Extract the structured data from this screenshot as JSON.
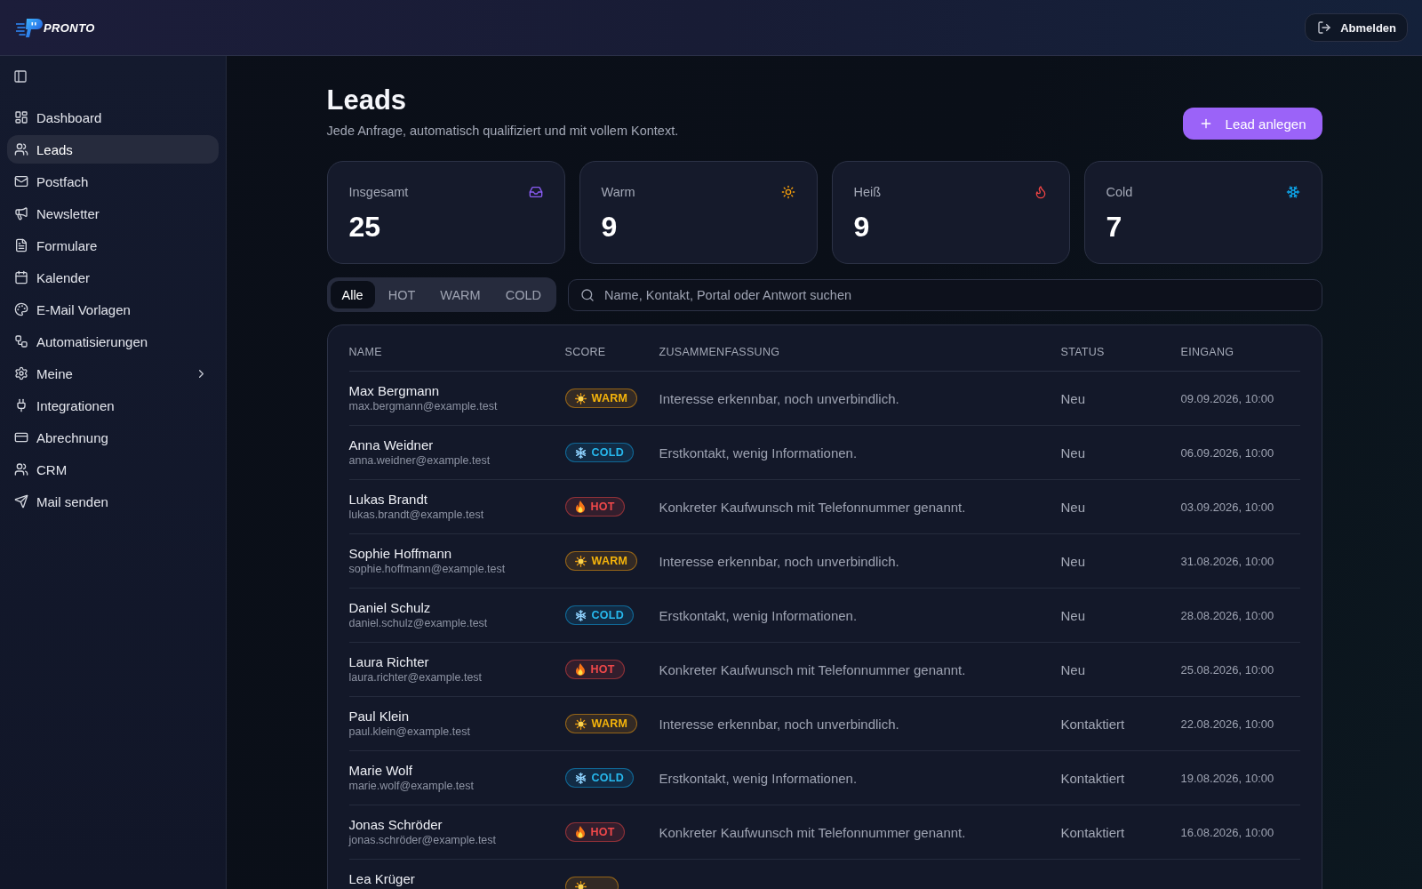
{
  "header": {
    "logo": "PRONTO",
    "logout": "Abmelden"
  },
  "sidebar": {
    "items": [
      {
        "label": "Dashboard",
        "kind": "link",
        "selected": false
      },
      {
        "label": "Leads",
        "kind": "link",
        "selected": true
      },
      {
        "label": "Postfach",
        "kind": "link",
        "selected": false
      },
      {
        "label": "Newsletter",
        "kind": "link",
        "selected": false
      },
      {
        "label": "Formulare",
        "kind": "link",
        "selected": false
      },
      {
        "label": "Kalender",
        "kind": "link",
        "selected": false
      },
      {
        "label": "E-Mail Vorlagen",
        "kind": "link",
        "selected": false
      },
      {
        "label": "Automatisierungen",
        "kind": "link",
        "selected": false
      },
      {
        "label": "Meine",
        "kind": "group",
        "expanded": false,
        "selected": false
      },
      {
        "label": "Integrationen",
        "kind": "link",
        "selected": false
      },
      {
        "label": "Abrechnung",
        "kind": "link",
        "selected": false
      },
      {
        "label": "CRM",
        "kind": "link",
        "selected": false
      },
      {
        "label": "Mail senden",
        "kind": "link",
        "selected": false
      }
    ]
  },
  "page": {
    "title": "Leads",
    "subtitle": "Jede Anfrage, automatisch qualifiziert und mit vollem Kontext.",
    "action": "Lead anlegen"
  },
  "stats": [
    {
      "kind": "total",
      "label": "Insgesamt",
      "value": "25"
    },
    {
      "kind": "warm",
      "label": "Warm",
      "value": "9"
    },
    {
      "kind": "hot",
      "label": "Heiß",
      "value": "9"
    },
    {
      "kind": "cold",
      "label": "Cold",
      "value": "7"
    }
  ],
  "filters": [
    {
      "label": "Alle",
      "selected": true
    },
    {
      "label": "HOT",
      "selected": false
    },
    {
      "label": "WARM",
      "selected": false
    },
    {
      "label": "COLD",
      "selected": false
    }
  ],
  "search": {
    "placeholder": "Name, Kontakt, Portal oder Antwort suchen"
  },
  "table": {
    "columns": [
      "NAME",
      "SCORE",
      "ZUSAMMENFASSUNG",
      "STATUS",
      "EINGANG"
    ],
    "rows": [
      {
        "name": "Max Bergmann",
        "email": "max.bergmann@example.test",
        "score": {
          "kind": "warm",
          "label": "WARM"
        },
        "summary": "Interesse erkennbar, noch unverbindlich.",
        "status": "Neu",
        "received": "09.09.2026, 10:00"
      },
      {
        "name": "Anna Weidner",
        "email": "anna.weidner@example.test",
        "score": {
          "kind": "cold",
          "label": "COLD"
        },
        "summary": "Erstkontakt, wenig Informationen.",
        "status": "Neu",
        "received": "06.09.2026, 10:00"
      },
      {
        "name": "Lukas Brandt",
        "email": "lukas.brandt@example.test",
        "score": {
          "kind": "hot",
          "label": "HOT"
        },
        "summary": "Konkreter Kaufwunsch mit Telefonnummer genannt.",
        "status": "Neu",
        "received": "03.09.2026, 10:00"
      },
      {
        "name": "Sophie Hoffmann",
        "email": "sophie.hoffmann@example.test",
        "score": {
          "kind": "warm",
          "label": "WARM"
        },
        "summary": "Interesse erkennbar, noch unverbindlich.",
        "status": "Neu",
        "received": "31.08.2026, 10:00"
      },
      {
        "name": "Daniel Schulz",
        "email": "daniel.schulz@example.test",
        "score": {
          "kind": "cold",
          "label": "COLD"
        },
        "summary": "Erstkontakt, wenig Informationen.",
        "status": "Neu",
        "received": "28.08.2026, 10:00"
      },
      {
        "name": "Laura Richter",
        "email": "laura.richter@example.test",
        "score": {
          "kind": "hot",
          "label": "HOT"
        },
        "summary": "Konkreter Kaufwunsch mit Telefonnummer genannt.",
        "status": "Neu",
        "received": "25.08.2026, 10:00"
      },
      {
        "name": "Paul Klein",
        "email": "paul.klein@example.test",
        "score": {
          "kind": "warm",
          "label": "WARM"
        },
        "summary": "Interesse erkennbar, noch unverbindlich.",
        "status": "Kontaktiert",
        "received": "22.08.2026, 10:00"
      },
      {
        "name": "Marie Wolf",
        "email": "marie.wolf@example.test",
        "score": {
          "kind": "cold",
          "label": "COLD"
        },
        "summary": "Erstkontakt, wenig Informationen.",
        "status": "Kontaktiert",
        "received": "19.08.2026, 10:00"
      },
      {
        "name": "Jonas Schröder",
        "email": "jonas.schröder@example.test",
        "score": {
          "kind": "hot",
          "label": "HOT"
        },
        "summary": "Konkreter Kaufwunsch mit Telefonnummer genannt.",
        "status": "Kontaktiert",
        "received": "16.08.2026, 10:00"
      },
      {
        "name": "Lea Krüger",
        "score": {
          "kind": "warm"
        }
      }
    ]
  }
}
